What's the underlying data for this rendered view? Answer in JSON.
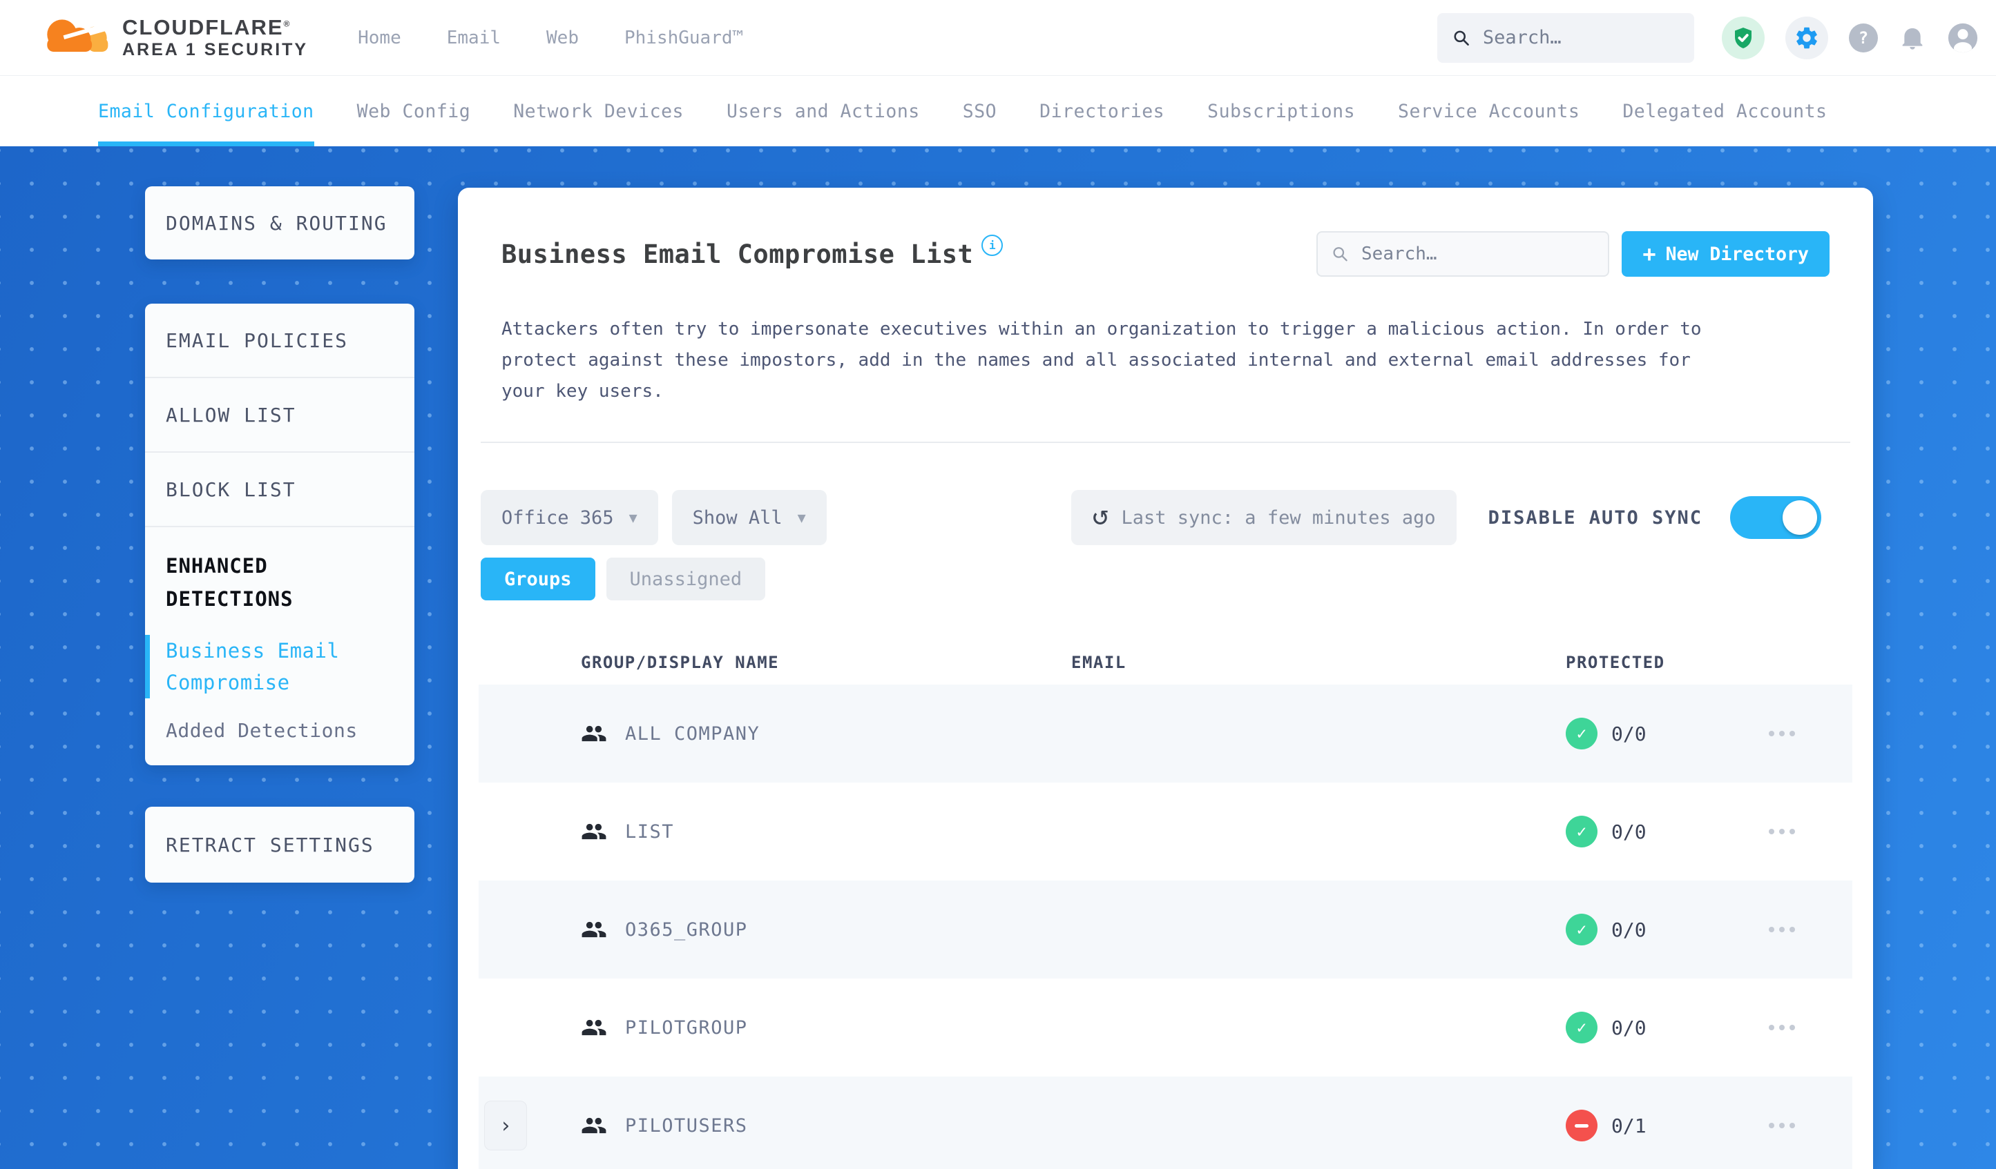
{
  "brand": {
    "name": "CLOUDFLARE",
    "mark": "®",
    "sub": "AREA 1 SECURITY"
  },
  "topnav": {
    "items": [
      {
        "label": "Home"
      },
      {
        "label": "Email"
      },
      {
        "label": "Web"
      },
      {
        "label": "PhishGuard™"
      }
    ],
    "search_placeholder": "Search…"
  },
  "subnav": {
    "items": [
      {
        "label": "Email Configuration",
        "active": true
      },
      {
        "label": "Web Config"
      },
      {
        "label": "Network Devices"
      },
      {
        "label": "Users and Actions"
      },
      {
        "label": "SSO"
      },
      {
        "label": "Directories"
      },
      {
        "label": "Subscriptions"
      },
      {
        "label": "Service Accounts"
      },
      {
        "label": "Delegated Accounts"
      }
    ]
  },
  "sidebar": {
    "domains_routing": "DOMAINS & ROUTING",
    "email_policies": "EMAIL POLICIES",
    "allow_list": "ALLOW LIST",
    "block_list": "BLOCK LIST",
    "enhanced_detections": "ENHANCED DETECTIONS",
    "business_email_compromise": "Business Email Compromise",
    "added_detections": "Added Detections",
    "retract_settings": "RETRACT SETTINGS"
  },
  "panel": {
    "title": "Business Email Compromise List",
    "search_placeholder": "Search…",
    "new_directory_plus": "+",
    "new_directory_label": "New Directory",
    "description": "Attackers often try to impersonate executives within an organization to trigger a malicious action. In order to protect against these impostors, add in the names and all associated internal and external email addresses for your key users.",
    "filters": {
      "directory": "Office 365",
      "show": "Show All",
      "last_sync": "Last sync: a few minutes ago",
      "auto_sync_label": "DISABLE AUTO SYNC",
      "auto_sync_on": true
    },
    "tabs": [
      {
        "label": "Groups",
        "active": true
      },
      {
        "label": "Unassigned",
        "active": false
      }
    ],
    "table": {
      "columns": [
        "GROUP/DISPLAY NAME",
        "EMAIL",
        "PROTECTED"
      ],
      "rows": [
        {
          "name": "ALL COMPANY",
          "email": "",
          "protected": "0/0",
          "status": "ok",
          "expandable": false
        },
        {
          "name": "LIST",
          "email": "",
          "protected": "0/0",
          "status": "ok",
          "expandable": false
        },
        {
          "name": "O365_GROUP",
          "email": "",
          "protected": "0/0",
          "status": "ok",
          "expandable": false
        },
        {
          "name": "PILOTGROUP",
          "email": "",
          "protected": "0/0",
          "status": "ok",
          "expandable": false
        },
        {
          "name": "PILOTUSERS",
          "email": "",
          "protected": "0/1",
          "status": "blocked",
          "expandable": true
        }
      ]
    }
  },
  "colors": {
    "accent": "#29b5f7",
    "ok_green": "#3ed598",
    "blocked_red": "#f4514d",
    "cloudflare_orange": "#f6821f",
    "cloudflare_light_orange": "#faae40",
    "workspace_blue_dark": "#1d66c9",
    "workspace_blue_light": "#2e87e7"
  }
}
